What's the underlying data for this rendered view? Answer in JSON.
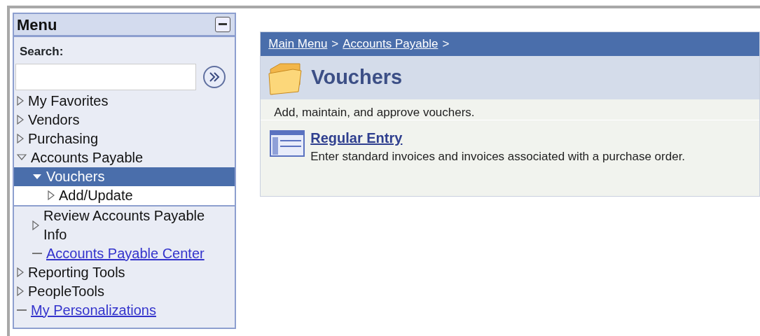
{
  "menu": {
    "title": "Menu",
    "search": {
      "label": "Search:"
    },
    "items": [
      {
        "label": "My Favorites",
        "kind": "folder",
        "expanded": false,
        "selected": false
      },
      {
        "label": "Vendors",
        "kind": "folder",
        "expanded": false,
        "selected": false
      },
      {
        "label": "Purchasing",
        "kind": "folder",
        "expanded": false,
        "selected": false
      },
      {
        "label": "Accounts Payable",
        "kind": "folder",
        "expanded": true,
        "selected": false,
        "children": [
          {
            "label": "Vouchers",
            "kind": "folder",
            "expanded": true,
            "selected": true,
            "children": [
              {
                "label": "Add/Update",
                "kind": "folder",
                "expanded": false,
                "selected": false
              }
            ]
          },
          {
            "label": "Review Accounts Payable Info",
            "kind": "folder",
            "expanded": false,
            "selected": false
          },
          {
            "label": "Accounts Payable Center",
            "kind": "link",
            "selected": false
          }
        ]
      },
      {
        "label": "Reporting Tools",
        "kind": "folder",
        "expanded": false,
        "selected": false
      },
      {
        "label": "PeopleTools",
        "kind": "folder",
        "expanded": false,
        "selected": false
      },
      {
        "label": "My Personalizations",
        "kind": "link",
        "selected": false
      }
    ]
  },
  "content": {
    "breadcrumb": [
      {
        "label": "Main Menu",
        "kind": "link"
      },
      {
        "label": ">",
        "kind": "separator"
      },
      {
        "label": "Accounts Payable",
        "kind": "link"
      },
      {
        "label": ">",
        "kind": "separator"
      }
    ],
    "title": "Vouchers",
    "description": "Add, maintain, and approve vouchers.",
    "entries": [
      {
        "title": "Regular Entry",
        "description": "Enter standard invoices and invoices associated with a purchase order."
      }
    ]
  }
}
